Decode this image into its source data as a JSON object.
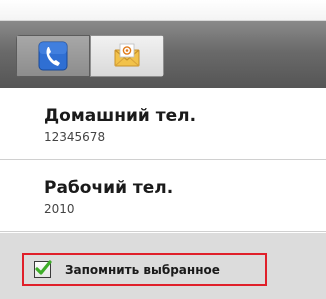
{
  "tabs": [
    {
      "icon": "phone-icon",
      "selected": true
    },
    {
      "icon": "email-icon",
      "selected": false
    }
  ],
  "numbers": [
    {
      "label": "Домашний тел.",
      "value": "12345678"
    },
    {
      "label": "Рабочий тел.",
      "value": "2010"
    }
  ],
  "remember": {
    "label": "Запомнить выбранное",
    "checked": true
  },
  "colors": {
    "tabbar": "#6a6a6a",
    "footer": "#dcdcdc",
    "highlight": "#e0202a",
    "check": "#3fae2a",
    "phone_icon_bg": "#2f6fd3"
  }
}
